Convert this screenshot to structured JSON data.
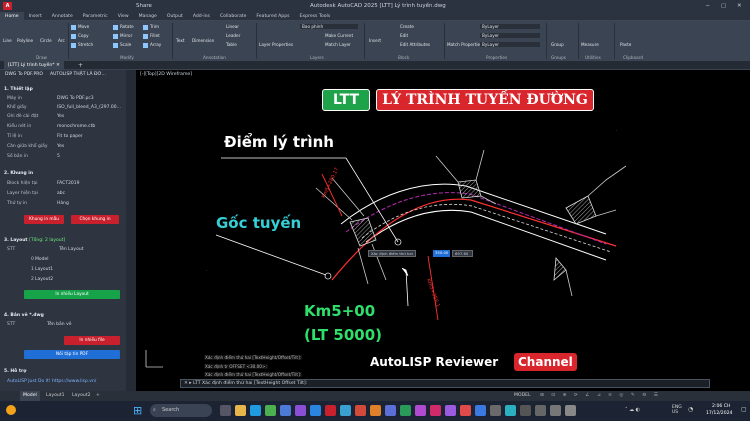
{
  "app": {
    "title": "Autodesk AutoCAD 2025  [LTT] Lý trình tuyến.dwg",
    "share": "Share"
  },
  "ribbon_tabs": [
    "Home",
    "Insert",
    "Annotate",
    "Parametric",
    "View",
    "Manage",
    "Output",
    "Add-ins",
    "Collaborate",
    "Featured Apps",
    "Express Tools"
  ],
  "ribbon": {
    "draw": [
      "Line",
      "Polyline",
      "Circle",
      "Arc"
    ],
    "modify": [
      "Move",
      "Rotate",
      "Trim",
      "Copy",
      "Mirror",
      "Fillet",
      "Stretch",
      "Scale",
      "Array"
    ],
    "annotation": [
      "Text",
      "Dimension",
      "Linear",
      "Leader",
      "Table"
    ],
    "layers": [
      "Layer Properties",
      "Make Current",
      "Match Layer"
    ],
    "layer_value": "Bao phinh",
    "block": [
      "Insert",
      "Create",
      "Edit",
      "Edit Attributes"
    ],
    "properties": [
      "Match Properties",
      "ByLayer",
      "ByLayer",
      "ByLayer"
    ],
    "groups": "Group",
    "utilities": "Measure",
    "clipboard": "Paste",
    "panel_names": [
      "Draw",
      "Modify",
      "Annotation",
      "Layers",
      "Block",
      "Properties",
      "Groups",
      "Utilities",
      "Clipboard"
    ]
  },
  "doc_tab": "[LTT] Lý trình tuyến*",
  "panel": {
    "tabs": [
      "DWG To PDF.PRO",
      "AUTOLISP THẬT LÀ ĐƠ..."
    ],
    "s1": "1.  Thiết lập",
    "rows1": [
      [
        "Máy in",
        "DWG To PDF.pc3"
      ],
      [
        "Khổ giấy",
        "ISO_full_bleed_A3_(297.00..."
      ],
      [
        "Ghi đè cài đặt",
        "Yes"
      ],
      [
        "Kiểu nét in",
        "monochrome.ctb"
      ],
      [
        "Tỉ lệ in",
        "Fit to paper"
      ],
      [
        "Căn giữa khổ giấy",
        "Yes"
      ],
      [
        "Số bản in",
        "5"
      ]
    ],
    "s2": "2.  Khung in",
    "rows2": [
      [
        "Block hiện tại",
        "FACT2019"
      ],
      [
        "Layer hiện tại",
        "abc"
      ],
      [
        "Thứ tự in",
        "Hàng"
      ]
    ],
    "btn_khung_mau": "Khung in mẫu",
    "btn_chon_khung": "Chọn khung in",
    "s3": "3.  Layout",
    "s3_note": "[Tổng: 2 layout]",
    "layout_hdr": [
      "STT",
      "Tên Layout"
    ],
    "layouts": [
      [
        "0",
        "Model"
      ],
      [
        "1",
        "Layout1"
      ],
      [
        "2",
        "Layout2"
      ]
    ],
    "btn_in_layout": "In nhiều Layout",
    "s4": "4.  Bản vẽ *.dwg",
    "dwg_hdr": [
      "STT",
      "Tên bản vẽ"
    ],
    "btn_in_nhieu_file": "In nhiều file",
    "btn_noi_pdf": "Nối tập tin PDF",
    "s5": "5.  Hỗ trợ",
    "help_text": "AutoLISP Just Do It!    https://www.lisp.vn/"
  },
  "viewport": {
    "label": "[-][Top][2D Wireframe]",
    "badge_ltt": "LTT",
    "title": "LÝ TRÌNH TUYẾN ĐƯỜNG",
    "diem_ly_trinh": "Điểm lý trình",
    "goc_tuyen": "Gốc tuyến",
    "km": "Km5+00",
    "lt": "(LT 5000)",
    "station_label_1": "Km5+280.17",
    "station_label_2": "Km5+356.1",
    "prompt_text": "Xác định điểm thứ hai",
    "prompt_val1": "350.00",
    "prompt_val2": "697.60",
    "reviewer": "AutoLISP Reviewer",
    "channel": "Channel"
  },
  "history": [
    "Xác định điểm thứ hai [TextHeight/Offset/Tilt]:",
    "Xác định tr OFFSET <30.00>:",
    "Xác định điểm thứ hai [TextHeight/Offset/Tilt]:"
  ],
  "command": "LTT Xác định điểm thứ hai [TextHeight Offset Tilt]:",
  "layout_tabs": [
    "Model",
    "Layout1",
    "Layout2"
  ],
  "model_label": "MODEL",
  "taskbar": {
    "search": "Search",
    "lang": "ENG\nUS",
    "time": "2:06 CH",
    "date": "17/12/2024"
  },
  "colors": {
    "red": "#d9262c",
    "green": "#1fa34a",
    "cyan": "#35d0d6",
    "magenta": "#b62bb3",
    "accent": "#1f6fd6"
  }
}
